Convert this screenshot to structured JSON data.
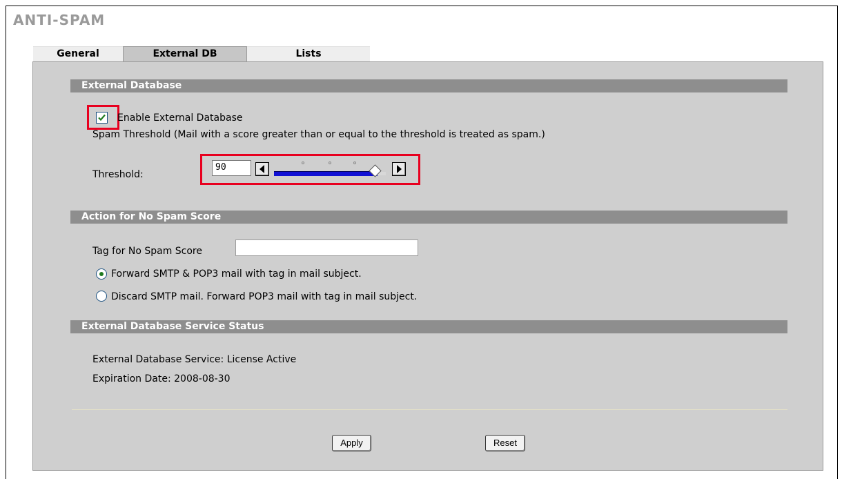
{
  "page": {
    "title": "ANTI-SPAM"
  },
  "tabs": [
    {
      "label": "General",
      "active": false
    },
    {
      "label": "External DB",
      "active": true
    },
    {
      "label": "Lists",
      "active": false
    }
  ],
  "external_database": {
    "section_title": "External Database",
    "enable_label": "Enable External Database",
    "enable_checked": true,
    "threshold_description": "Spam Threshold (Mail with a score greater than or equal to the threshold is treated as spam.)",
    "threshold_label": "Threshold:",
    "threshold_value": "90"
  },
  "no_spam_score": {
    "section_title": "Action for No Spam Score",
    "tag_label": "Tag for No Spam Score",
    "tag_value": "",
    "options": [
      {
        "label": "Forward SMTP & POP3 mail with tag in mail subject.",
        "selected": true
      },
      {
        "label": "Discard SMTP mail. Forward POP3 mail with tag in mail subject.",
        "selected": false
      }
    ]
  },
  "service_status": {
    "section_title": "External Database Service Status",
    "service_line": "External Database Service: License Active",
    "expiration_line": "Expiration Date: 2008-08-30"
  },
  "buttons": {
    "apply": "Apply",
    "reset": "Reset"
  },
  "colors": {
    "section_bar": "#8e8e8e",
    "panel": "#cfcfcf",
    "highlight": "#e8001f",
    "slider": "#1010d4"
  }
}
